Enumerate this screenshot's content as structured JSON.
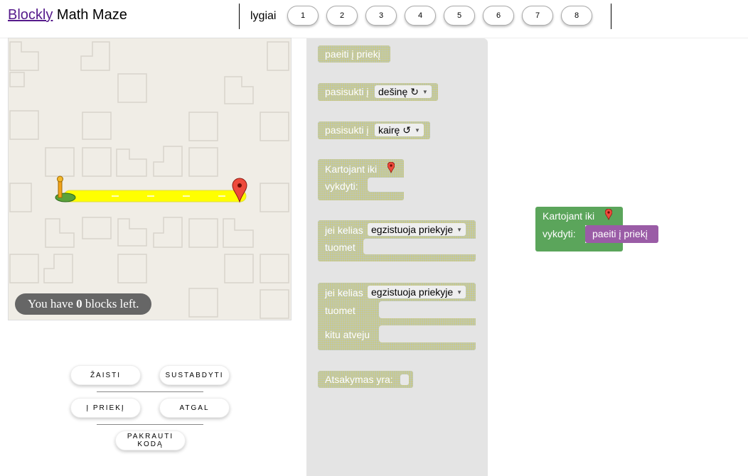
{
  "header": {
    "title_link": "Blockly",
    "title_rest": " Math Maze",
    "levels_label": "lygiai",
    "levels": [
      "1",
      "2",
      "3",
      "4",
      "5",
      "6",
      "7",
      "8"
    ]
  },
  "maze": {
    "blocks_left_prefix": "You have ",
    "blocks_left_count": "0",
    "blocks_left_suffix": " blocks left."
  },
  "controls": {
    "play": "ŽAISTI",
    "stop": "SUSTABDYTI",
    "forward": "Į PRIEKĮ",
    "back": "ATGAL",
    "load_code": "PAKRAUTI KODĄ"
  },
  "toolbox": {
    "move_forward": "paeiti į priekį",
    "turn_prefix": "pasisukti į",
    "turn_right": "dešinę ↻",
    "turn_left": "kairę ↺",
    "repeat_until": "Kartojant iki",
    "do": "vykdyti:",
    "if_path": "jei kelias",
    "path_ahead": "egzistuoja priekyje",
    "then": "tuomet",
    "else": "kitu atveju",
    "answer": "Atsakymas yra:"
  },
  "workspace": {
    "repeat_until": "Kartojant iki",
    "do": "vykdyti:",
    "move_forward": "paeiti į priekį"
  },
  "colors": {
    "toolbox_block": "#c9c98a",
    "loop_block": "#5ba55b",
    "move_block": "#9a5ca6",
    "path": "#ffff00",
    "link": "#551a8b"
  }
}
